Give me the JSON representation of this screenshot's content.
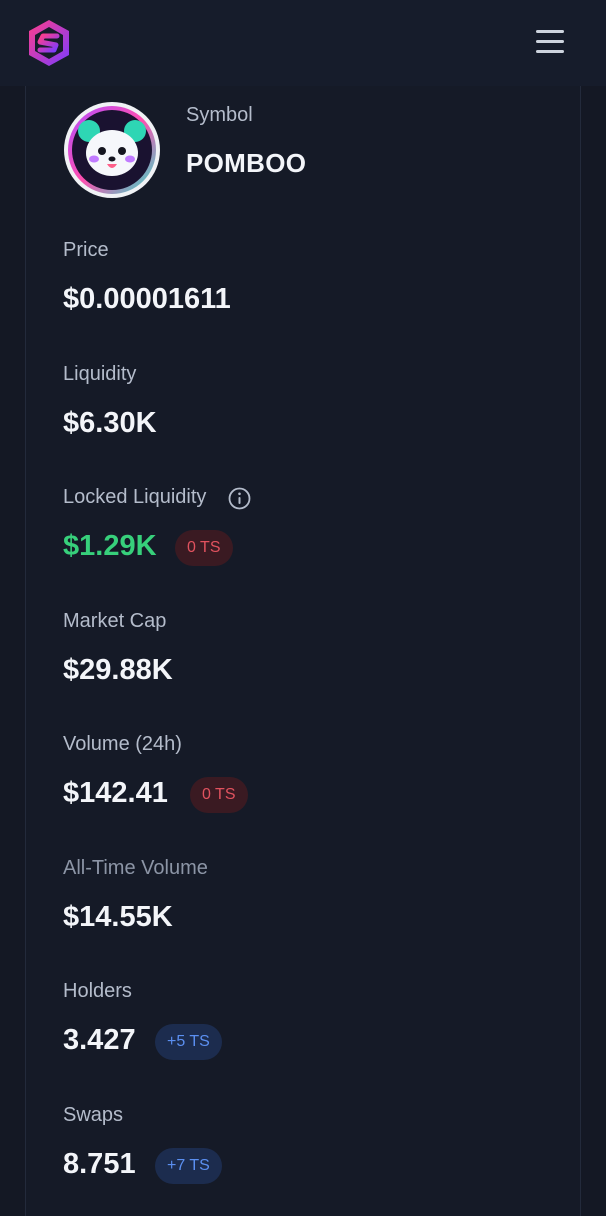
{
  "token": {
    "symbol_label": "Symbol",
    "symbol": "POMBOO"
  },
  "stats": {
    "price": {
      "label": "Price",
      "value": "$0.00001611"
    },
    "liquidity": {
      "label": "Liquidity",
      "value": "$6.30K"
    },
    "locked_liquidity": {
      "label": "Locked Liquidity",
      "value": "$1.29K",
      "badge": "0 TS"
    },
    "market_cap": {
      "label": "Market Cap",
      "value": "$29.88K"
    },
    "volume_24h": {
      "label": "Volume (24h)",
      "value": "$142.41",
      "badge": "0 TS"
    },
    "all_time_volume": {
      "label": "All-Time Volume",
      "value": "$14.55K"
    },
    "holders": {
      "label": "Holders",
      "value": "3.427",
      "badge": "+5 TS"
    },
    "swaps": {
      "label": "Swaps",
      "value": "8.751",
      "badge": "+7 TS"
    }
  },
  "colors": {
    "background": "#141824",
    "positive": "#37d07b",
    "negative": "#e0525e",
    "info": "#5b8ff0"
  },
  "icons": {
    "logo": "app-logo-icon",
    "menu": "hamburger-menu-icon",
    "info": "info-circle-icon"
  }
}
